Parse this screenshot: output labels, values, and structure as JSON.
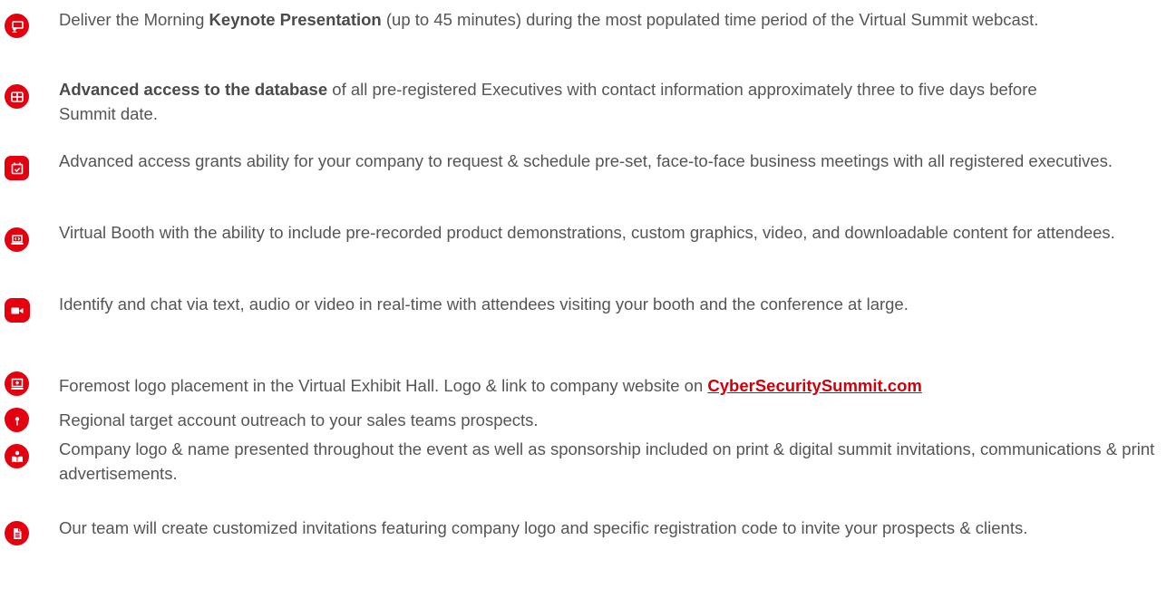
{
  "accent_color": "#e4000f",
  "items": [
    {
      "icon": "presentation-icon",
      "pre": "Deliver the Morning ",
      "bold": "Keynote Presentation",
      "post": " (up to 45 minutes) during the most populated time period of the Virtual Summit webcast."
    },
    {
      "icon": "database-table-icon",
      "pre": "",
      "bold": "Advanced access to the database",
      "post": " of all pre-registered Executives with contact information approximately three to five days before Summit date."
    },
    {
      "icon": "calendar-check-icon",
      "pre": "Advanced access grants ability for your company to request & schedule pre-set, face-to-face business meetings with all registered executives.",
      "bold": "",
      "post": ""
    },
    {
      "icon": "laptop-code-icon",
      "pre": "Virtual Booth with the ability to include pre-recorded product demonstrations, custom graphics, video, and downloadable content for attendees.",
      "bold": "",
      "post": ""
    },
    {
      "icon": "video-camera-icon",
      "pre": "Identify and chat via text, audio or video in real-time with attendees visiting your booth and the conference at large.",
      "bold": "",
      "post": ""
    },
    {
      "icon": "monitor-plus-icon",
      "pre": "Foremost logo placement in the Virtual Exhibit Hall. Logo & link to company website on ",
      "bold": "",
      "post": "",
      "link": "CyberSecuritySummit.com"
    },
    {
      "icon": "map-pin-icon",
      "pre": "Regional target account outreach to your sales teams prospects.",
      "bold": "",
      "post": ""
    },
    {
      "icon": "reader-book-icon",
      "pre": "Company logo & name presented throughout the event as well as sponsorship included on print & digital summit invitations, communications & print advertisements.",
      "bold": "",
      "post": ""
    },
    {
      "icon": "document-icon",
      "pre": "Our team will create customized invitations featuring company logo and specific registration code to invite your prospects & clients.",
      "bold": "",
      "post": ""
    }
  ]
}
